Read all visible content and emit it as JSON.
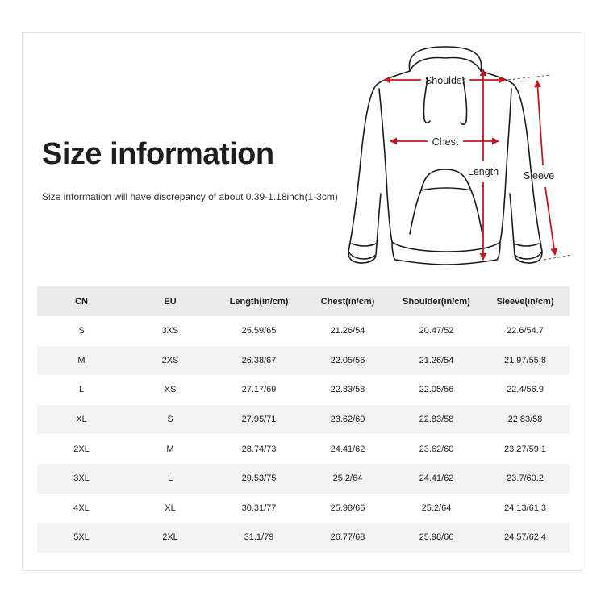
{
  "heading": {
    "title": "Size information",
    "subtitle": "Size information will have discrepancy of about 0.39-1.18inch(1-3cm)"
  },
  "diagram": {
    "labels": {
      "shoulder": "Shoulder",
      "chest": "Chest",
      "length": "Length",
      "sleeve": "Sleeve"
    },
    "arrow_color": "#c0181f"
  },
  "table": {
    "headers": [
      "CN",
      "EU",
      "Length(in/cm)",
      "Chest(in/cm)",
      "Shoulder(in/cm)",
      "Sleeve(in/cm)"
    ],
    "rows": [
      [
        "S",
        "3XS",
        "25.59/65",
        "21.26/54",
        "20.47/52",
        "22.6/54.7"
      ],
      [
        "M",
        "2XS",
        "26.38/67",
        "22.05/56",
        "21.26/54",
        "21.97/55.8"
      ],
      [
        "L",
        "XS",
        "27.17/69",
        "22.83/58",
        "22.05/56",
        "22.4/56.9"
      ],
      [
        "XL",
        "S",
        "27.95/71",
        "23.62/60",
        "22.83/58",
        "22.83/58"
      ],
      [
        "2XL",
        "M",
        "28.74/73",
        "24.41/62",
        "23.62/60",
        "23.27/59.1"
      ],
      [
        "3XL",
        "L",
        "29.53/75",
        "25.2/64",
        "24.41/62",
        "23.7/60.2"
      ],
      [
        "4XL",
        "XL",
        "30.31/77",
        "25.98/66",
        "25.2/64",
        "24.13/61.3"
      ],
      [
        "5XL",
        "2XL",
        "31.1/79",
        "26.77/68",
        "25.98/66",
        "24.57/62.4"
      ]
    ]
  }
}
